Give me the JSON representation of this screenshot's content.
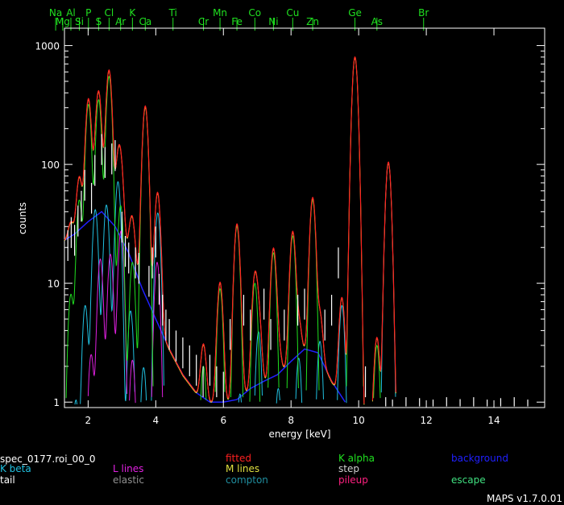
{
  "spectrum_name": "spec_0177.roi_00_0",
  "version": "MAPS v1.7.0.01",
  "legend": [
    {
      "label": "fitted",
      "color": "#ff2020"
    },
    {
      "label": "K alpha",
      "color": "#20e020"
    },
    {
      "label": "background",
      "color": "#2020ff"
    },
    {
      "label": "K beta",
      "color": "#20c0e0"
    },
    {
      "label": "L lines",
      "color": "#e020e0"
    },
    {
      "label": "M lines",
      "color": "#e0e040"
    },
    {
      "label": "step",
      "color": "#d0d0d0"
    },
    {
      "label": "tail",
      "color": "#ffffff"
    },
    {
      "label": "elastic",
      "color": "#909090"
    },
    {
      "label": "compton",
      "color": "#208fa0"
    },
    {
      "label": "pileup",
      "color": "#ff2080"
    },
    {
      "label": "escape",
      "color": "#40e080"
    }
  ],
  "chart_data": {
    "type": "line",
    "xlabel": "energy [keV]",
    "ylabel": "counts",
    "x_range": [
      1.3,
      15.5
    ],
    "y_range": [
      0.9,
      1400
    ],
    "y_scale": "log",
    "x_ticks": [
      2,
      4,
      6,
      8,
      10,
      12,
      14
    ],
    "x_tick_labels": [
      "2",
      "4",
      "6",
      "8",
      "10",
      "12",
      "14"
    ],
    "y_ticks": [
      1,
      10,
      100,
      1000
    ],
    "y_tick_labels": [
      "1",
      "10",
      "100",
      "1000"
    ],
    "element_markers": [
      {
        "name": "Na",
        "energy": 1.04
      },
      {
        "name": "Mg",
        "energy": 1.25
      },
      {
        "name": "Al",
        "energy": 1.49
      },
      {
        "name": "Si",
        "energy": 1.74
      },
      {
        "name": "P",
        "energy": 2.01
      },
      {
        "name": "S",
        "energy": 2.31
      },
      {
        "name": "Cl",
        "energy": 2.62
      },
      {
        "name": "Ar",
        "energy": 2.96
      },
      {
        "name": "K",
        "energy": 3.31
      },
      {
        "name": "Ca",
        "energy": 3.69
      },
      {
        "name": "Ti",
        "energy": 4.51
      },
      {
        "name": "Cr",
        "energy": 5.41
      },
      {
        "name": "Mn",
        "energy": 5.9
      },
      {
        "name": "Fe",
        "energy": 6.4
      },
      {
        "name": "Co",
        "energy": 6.93
      },
      {
        "name": "Ni",
        "energy": 7.48
      },
      {
        "name": "Cu",
        "energy": 8.05
      },
      {
        "name": "Zn",
        "energy": 8.64
      },
      {
        "name": "Ge",
        "energy": 9.89
      },
      {
        "name": "As",
        "energy": 10.54
      },
      {
        "name": "Br",
        "energy": 11.92
      }
    ],
    "peaks": [
      {
        "element": "Al",
        "energy": 1.49,
        "height": 8
      },
      {
        "element": "Si",
        "energy": 1.74,
        "height": 50
      },
      {
        "element": "P",
        "energy": 2.01,
        "height": 320
      },
      {
        "element": "S",
        "energy": 2.31,
        "height": 350
      },
      {
        "element": "Cl",
        "energy": 2.62,
        "height": 550
      },
      {
        "element": "Ar",
        "energy": 2.96,
        "height": 45
      },
      {
        "element": "K",
        "energy": 3.31,
        "height": 15
      },
      {
        "element": "Ca",
        "energy": 3.69,
        "height": 300
      },
      {
        "element": "Cr",
        "energy": 5.41,
        "height": 2
      },
      {
        "element": "Mn",
        "energy": 5.9,
        "height": 9
      },
      {
        "element": "Fe",
        "energy": 6.4,
        "height": 30
      },
      {
        "element": "Co",
        "energy": 6.93,
        "height": 10
      },
      {
        "element": "Ni",
        "energy": 7.48,
        "height": 18
      },
      {
        "element": "Cu",
        "energy": 8.05,
        "height": 25
      },
      {
        "element": "Zn",
        "energy": 8.64,
        "height": 50
      },
      {
        "element": "Ge",
        "energy": 9.89,
        "height": 800
      },
      {
        "element": "As",
        "energy": 10.54,
        "height": 3
      }
    ],
    "background": {
      "x": [
        1.3,
        1.6,
        2.0,
        2.4,
        2.8,
        3.2,
        3.6,
        4.0,
        4.4,
        4.8,
        5.2,
        5.6,
        6.0,
        6.4,
        6.8,
        7.2,
        7.6,
        8.0,
        8.4,
        8.8,
        9.2,
        9.6
      ],
      "y": [
        23,
        26,
        33,
        40,
        30,
        18,
        9,
        5,
        2.8,
        1.7,
        1.2,
        1.0,
        1.0,
        1.05,
        1.3,
        1.5,
        1.7,
        2.2,
        2.8,
        2.6,
        1.5,
        1.0
      ]
    },
    "data_points": {
      "x": [
        1.4,
        1.5,
        1.6,
        1.7,
        1.8,
        1.9,
        2.1,
        2.2,
        2.4,
        2.5,
        2.7,
        2.8,
        3.0,
        3.1,
        3.2,
        3.4,
        3.5,
        3.8,
        3.9,
        4.0,
        4.1,
        4.2,
        4.3,
        4.4,
        4.6,
        4.8,
        5.0,
        5.2,
        5.4,
        5.6,
        5.8,
        6.0,
        6.2,
        6.6,
        6.8,
        7.2,
        7.4,
        7.8,
        8.2,
        8.4,
        9.0,
        9.2,
        9.4,
        10.2,
        10.8,
        11.0,
        11.4,
        11.8,
        12.2,
        12.6,
        13.0,
        13.4,
        13.8,
        14.2,
        14.6,
        15.0
      ],
      "y": [
        28,
        36,
        31,
        45,
        60,
        90,
        70,
        120,
        180,
        140,
        150,
        160,
        40,
        25,
        22,
        20,
        18,
        14,
        20,
        30,
        12,
        8,
        6,
        5,
        4,
        3.5,
        3,
        2.5,
        2,
        2.5,
        2,
        1.8,
        5,
        8,
        6,
        9,
        5,
        6,
        8,
        9,
        6,
        8,
        20,
        2,
        1.1,
        1.05,
        1.1,
        1.08,
        1.05,
        1.1,
        1.06,
        1.1,
        1.05,
        1.08,
        1.1,
        1.05
      ]
    }
  }
}
